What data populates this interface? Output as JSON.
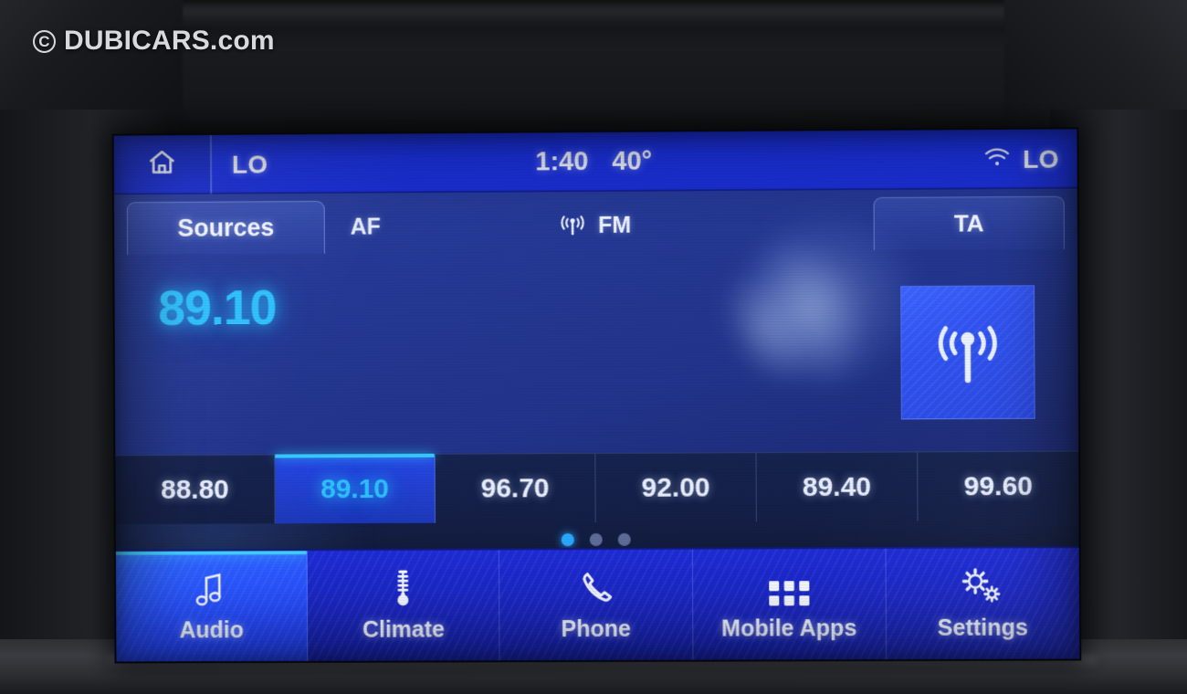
{
  "watermark": {
    "symbol": "C",
    "text": "DUBICARS.com"
  },
  "statusbar": {
    "home_icon": "home-icon",
    "climate_left": "LO",
    "time": "1:40",
    "temperature": "40°",
    "signal_icon": "wifi-signal-icon",
    "climate_right": "LO"
  },
  "audio": {
    "sources_label": "Sources",
    "af_label": "AF",
    "band_icon": "broadcast-icon",
    "band_label": "FM",
    "ta_label": "TA",
    "current_frequency": "89.10",
    "antenna_icon": "antenna-broadcast-icon",
    "presets": [
      {
        "label": "88.80",
        "active": false
      },
      {
        "label": "89.10",
        "active": true
      },
      {
        "label": "96.70",
        "active": false
      },
      {
        "label": "92.00",
        "active": false
      },
      {
        "label": "89.40",
        "active": false
      },
      {
        "label": "99.60",
        "active": false
      }
    ],
    "pager": {
      "total": 3,
      "current": 1
    }
  },
  "navbar": {
    "items": [
      {
        "label": "Audio",
        "icon": "music-note-icon",
        "active": true
      },
      {
        "label": "Climate",
        "icon": "thermometer-icon",
        "active": false
      },
      {
        "label": "Phone",
        "icon": "phone-handset-icon",
        "active": false
      },
      {
        "label": "Mobile Apps",
        "icon": "app-grid-icon",
        "active": false
      },
      {
        "label": "Settings",
        "icon": "gears-icon",
        "active": false
      }
    ]
  },
  "colors": {
    "accent_cyan": "#2ec2ff",
    "brand_blue": "#1c33e6",
    "panel_blue": "#22348c",
    "text_white": "#f2f5ff"
  }
}
